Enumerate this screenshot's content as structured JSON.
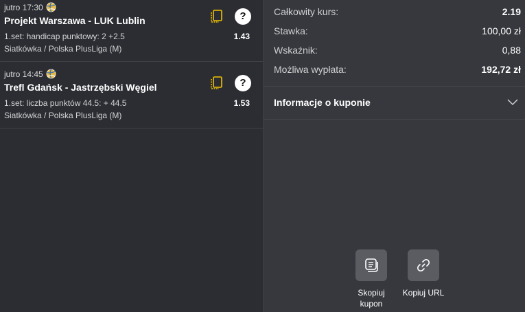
{
  "events": [
    {
      "time": "jutro 17:30",
      "title": "Projekt Warszawa - LUK Lublin",
      "market": "1.set: handicap punktowy: 2 +2.5",
      "league": "Siatkówka / Polska PlusLiga (M)",
      "odds": "1.43",
      "help": "?"
    },
    {
      "time": "jutro 14:45",
      "title": "Trefl Gdańsk - Jastrzębski Węgiel",
      "market": "1.set: liczba punktów 44.5: + 44.5",
      "league": "Siatkówka / Polska PlusLiga (M)",
      "odds": "1.53",
      "help": "?"
    }
  ],
  "summary": {
    "total_odds_label": "Całkowity kurs:",
    "total_odds_value": "2.19",
    "stake_label": "Stawka:",
    "stake_value": "100,00 zł",
    "indicator_label": "Wskaźnik:",
    "indicator_value": "0,88",
    "payout_label": "Możliwa wypłata:",
    "payout_value": "192,72 zł"
  },
  "info": {
    "label": "Informacje o kuponie"
  },
  "actions": {
    "copy_coupon_line1": "Skopiuj",
    "copy_coupon_line2": "kupon",
    "copy_url": "Kopiuj URL"
  },
  "colors": {
    "left_bg": "#2b2d33",
    "right_bg": "#36383e",
    "accent_yellow": "#f2c300",
    "button_bg": "#5a5c62"
  },
  "icons": [
    "volleyball-icon",
    "coupon-doc-icon",
    "help-icon",
    "chevron-down-icon",
    "copy-coupon-icon",
    "link-icon"
  ]
}
